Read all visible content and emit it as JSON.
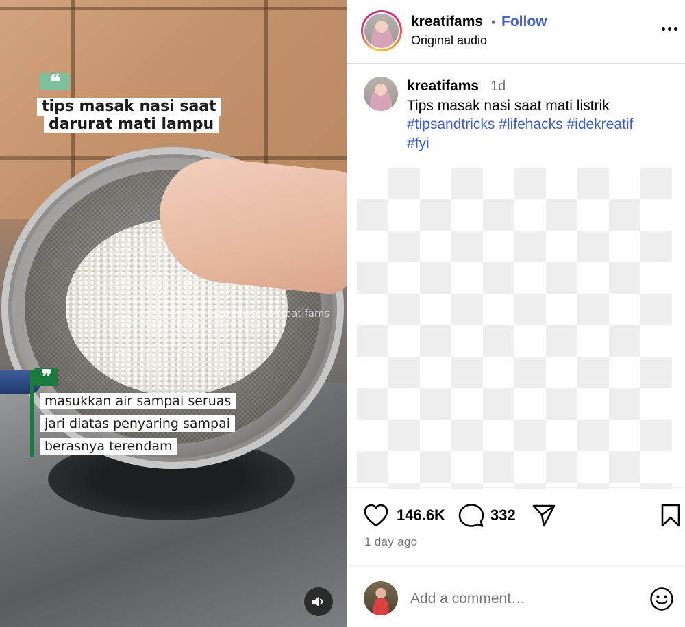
{
  "video": {
    "title_line1": "tips masak nasi saat",
    "title_line2": "darurat mati lampu",
    "caption_lines": [
      "masukkan air sampai seruas",
      "jari diatas penyaring sampai",
      "berasnya terendam"
    ],
    "watermark": "arpaliyanti-kreatifams"
  },
  "header": {
    "username": "kreatifams",
    "separator": "•",
    "follow_label": "Follow",
    "audio_label": "Original audio"
  },
  "caption": {
    "username": "kreatifams",
    "time": "1d",
    "text": "Tips masak nasi saat mati listrik",
    "hashtags": [
      "#tipsandtricks",
      "#lifehacks",
      "#idekreatif",
      "#fyi"
    ]
  },
  "actions": {
    "likes": "146.6K",
    "comments": "332"
  },
  "posted_ago": "1 day ago",
  "comment_box": {
    "placeholder": "Add a comment…",
    "value": ""
  },
  "colors": {
    "link_blue": "#3b5bdb",
    "muted_gray": "#737373",
    "quote_green_light": "#7ec09b",
    "quote_green_dark": "#1b7a3e"
  },
  "icons": [
    "heart-icon",
    "comment-icon",
    "share-icon",
    "bookmark-icon",
    "more-icon",
    "emoji-icon",
    "volume-icon"
  ]
}
